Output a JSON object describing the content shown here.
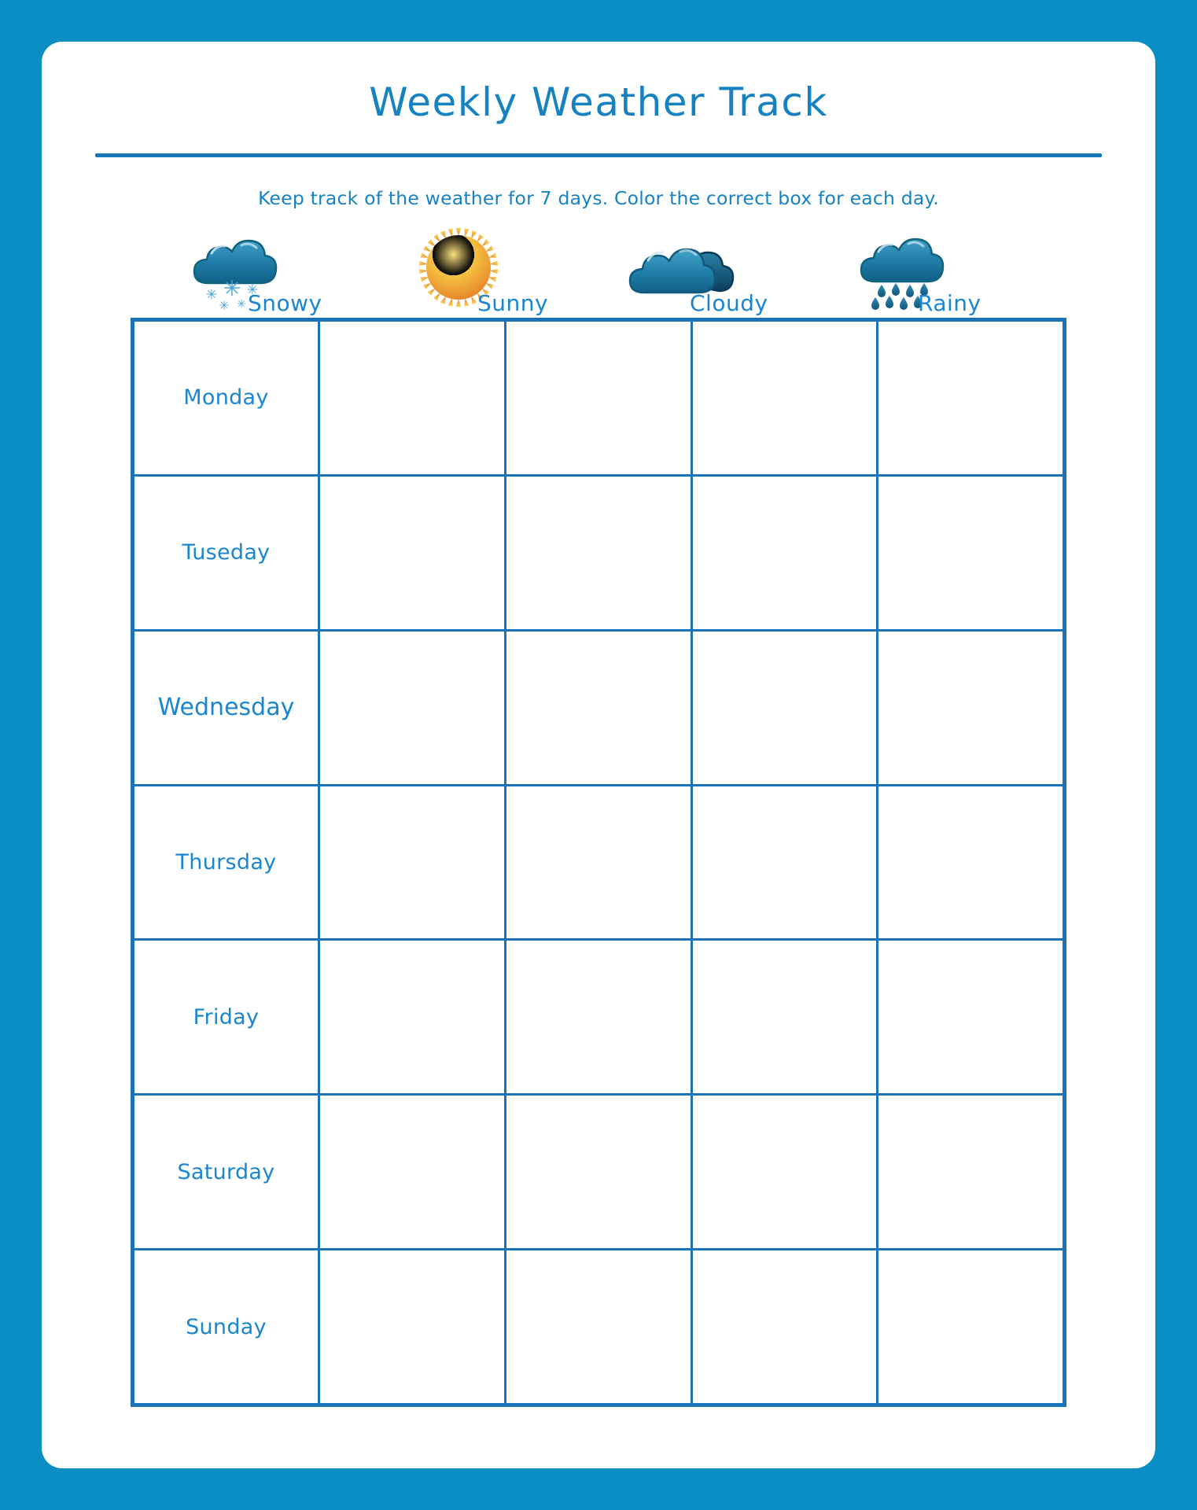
{
  "header": {
    "title": "Weekly Weather Track",
    "instructions": "Keep track of the weather for 7 days. Color the correct box for each day."
  },
  "colors": {
    "frame": "#0b8ec4",
    "title_text": "#1782c2",
    "divider": "#1577b8",
    "grid_line": "#1a72b8",
    "label_text": "#1a86d0",
    "cloud_dark": "#15678f",
    "cloud_light": "#2a87b5",
    "sun_yellow": "#f6d04a",
    "sun_orange": "#e98a25",
    "snowflake": "#3e9cc8",
    "raindrop": "#1d6e99"
  },
  "legend": {
    "columns": [
      {
        "label": "Snowy",
        "icon": "snowy-cloud-icon"
      },
      {
        "label": "Sunny",
        "icon": "sun-icon"
      },
      {
        "label": "Cloudy",
        "icon": "cloudy-double-cloud-icon"
      },
      {
        "label": "Rainy",
        "icon": "rainy-cloud-icon"
      }
    ]
  },
  "table": {
    "day_column_header": "",
    "rows": [
      {
        "day": "Monday"
      },
      {
        "day": "Tuseday"
      },
      {
        "day": "Wednesday"
      },
      {
        "day": "Thursday"
      },
      {
        "day": "Friday"
      },
      {
        "day": "Saturday"
      },
      {
        "day": "Sunday"
      }
    ]
  }
}
